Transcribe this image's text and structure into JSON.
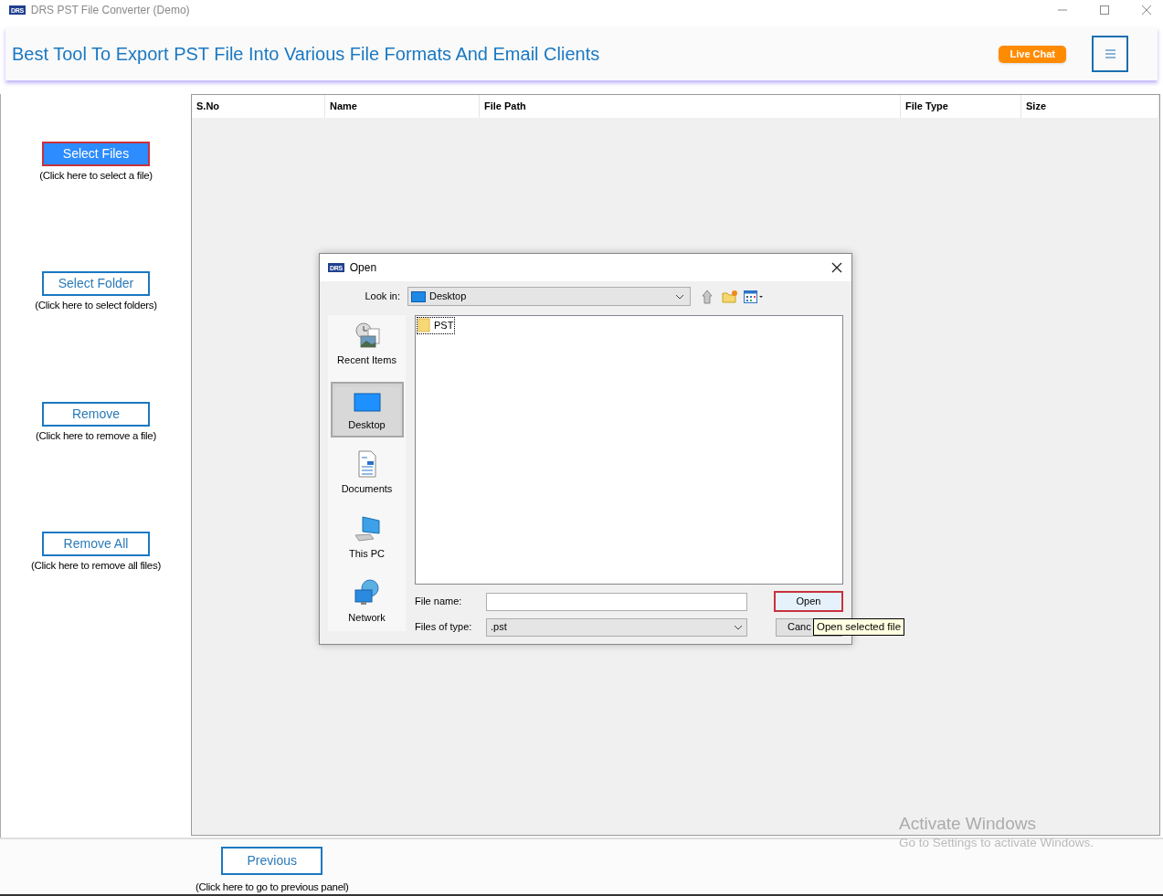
{
  "window": {
    "logo_text": "DRS",
    "title": "DRS PST File Converter (Demo)"
  },
  "header": {
    "headline": "Best Tool To Export PST File Into Various File Formats And Email Clients",
    "live_chat": "Live Chat"
  },
  "actions": [
    {
      "label": "Select Files",
      "hint": "(Click here to select a file)",
      "focused": true
    },
    {
      "label": "Select Folder",
      "hint": "(Click here to select folders)",
      "focused": false
    },
    {
      "label": "Remove",
      "hint": "(Click here to remove a file)",
      "focused": false
    },
    {
      "label": "Remove All",
      "hint": "(Click here to remove all files)",
      "focused": false
    }
  ],
  "table": {
    "columns": [
      "S.No",
      "Name",
      "File Path",
      "File Type",
      "Size"
    ]
  },
  "footer": {
    "label": "Previous",
    "hint": "(Click here to go to previous panel)"
  },
  "dialog": {
    "logo_text": "DRS",
    "title": "Open",
    "look_in_label": "Look in:",
    "look_in_value": "Desktop",
    "places": [
      {
        "kind": "recent",
        "label": "Recent Items",
        "selected": false
      },
      {
        "kind": "desktop",
        "label": "Desktop",
        "selected": true
      },
      {
        "kind": "documents",
        "label": "Documents",
        "selected": false
      },
      {
        "kind": "pc",
        "label": "This PC",
        "selected": false
      },
      {
        "kind": "network",
        "label": "Network",
        "selected": false
      }
    ],
    "files": [
      {
        "name": "PST",
        "selected": true
      }
    ],
    "file_name_label": "File name:",
    "files_of_type_label": "Files of type:",
    "files_of_type_value": ".pst",
    "open_button": "Open",
    "cancel_button": "Canc",
    "tooltip": "Open selected file"
  },
  "os_notice": {
    "title": "Activate Windows",
    "subtitle": "Go to Settings to activate Windows."
  }
}
